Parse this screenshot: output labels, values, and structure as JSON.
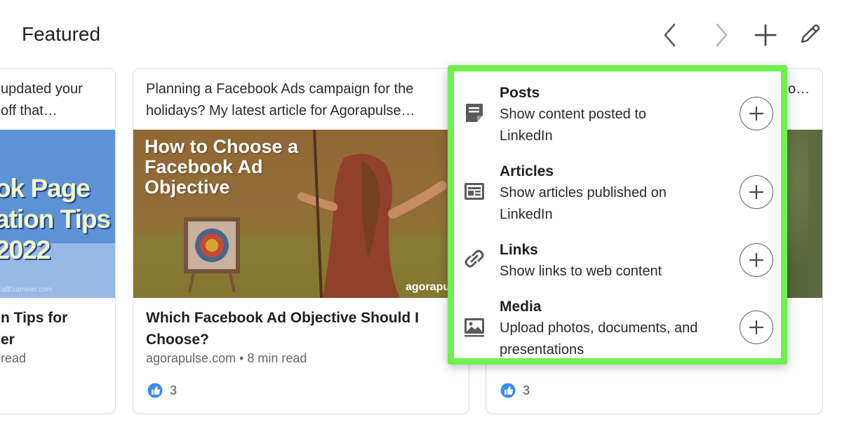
{
  "header": {
    "title": "Featured",
    "actions": [
      "chevron-left-icon",
      "chevron-right-icon",
      "plus-icon",
      "pencil-icon"
    ]
  },
  "cards": [
    {
      "description": "updated your\noff that…",
      "image_text": "ok Page\nation Tips\n2022",
      "image_credit": "ialExaminer.com",
      "title": "n Tips for\ner",
      "meta": "read"
    },
    {
      "description": "Planning a Facebook Ads campaign for the\nholidays? My latest article for Agorapulse…",
      "image_text": "How to Choose a\nFacebook Ad\nObjective",
      "image_brand": "agorapulse",
      "title": "Which Facebook Ad Objective Should I\nChoose?",
      "meta": "agorapulse.com • 8 min read",
      "likes": "3"
    },
    {
      "description": "o…",
      "likes": "3"
    }
  ],
  "popover": {
    "items": [
      {
        "icon": "note-icon",
        "label": "Posts",
        "desc": "Show content posted to\nLinkedIn"
      },
      {
        "icon": "article-icon",
        "label": "Articles",
        "desc": "Show articles published on\nLinkedIn"
      },
      {
        "icon": "link-icon",
        "label": "Links",
        "desc": "Show links to web content"
      },
      {
        "icon": "image-icon",
        "label": "Media",
        "desc": "Upload photos, documents, and\npresentations"
      }
    ]
  },
  "colors": {
    "highlight": "#6ef04f",
    "like_blue": "#378fe9",
    "text": "#1f1f1f"
  }
}
